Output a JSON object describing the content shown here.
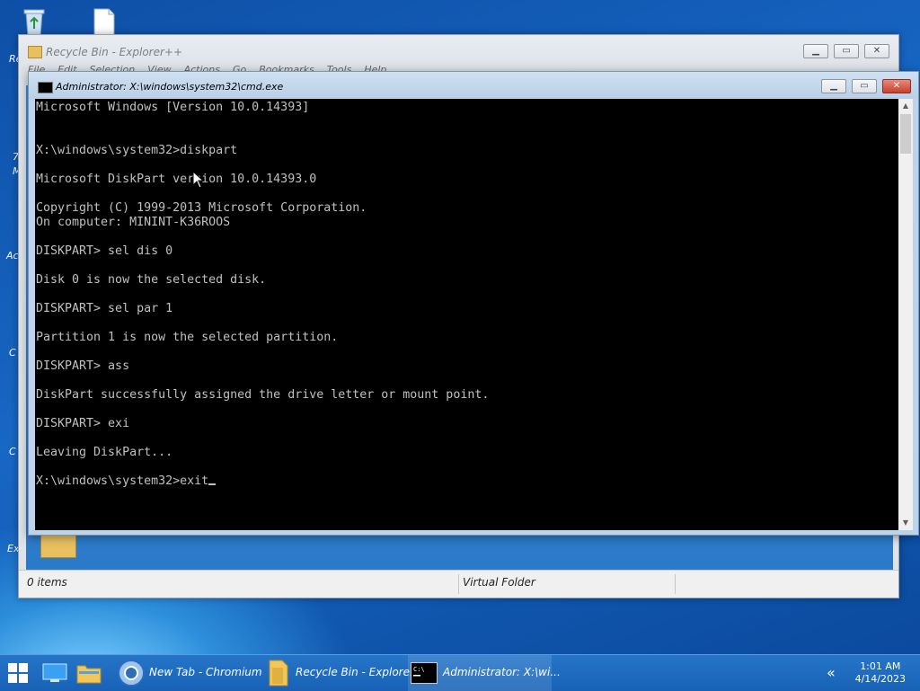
{
  "desktop": {
    "icons": [
      {
        "name": "recycle-bin",
        "label": "Re"
      },
      {
        "name": "file",
        "label": ""
      }
    ],
    "side_labels": [
      "7",
      "M",
      "Ac",
      "C",
      "C",
      "Ex"
    ]
  },
  "explorer": {
    "title": "Recycle Bin - Explorer++",
    "menu": [
      "File",
      "Edit",
      "Selection",
      "View",
      "Actions",
      "Go",
      "Bookmarks",
      "Tools",
      "Help"
    ],
    "status_left": "0 items",
    "status_right": "Virtual Folder"
  },
  "cmd": {
    "title": "Administrator: X:\\windows\\system32\\cmd.exe",
    "lines": [
      "Microsoft Windows [Version 10.0.14393]",
      "",
      "",
      "X:\\windows\\system32>diskpart",
      "",
      "Microsoft DiskPart version 10.0.14393.0",
      "",
      "Copyright (C) 1999-2013 Microsoft Corporation.",
      "On computer: MININT-K36ROOS",
      "",
      "DISKPART> sel dis 0",
      "",
      "Disk 0 is now the selected disk.",
      "",
      "DISKPART> sel par 1",
      "",
      "Partition 1 is now the selected partition.",
      "",
      "DISKPART> ass",
      "",
      "DiskPart successfully assigned the drive letter or mount point.",
      "",
      "DISKPART> exi",
      "",
      "Leaving DiskPart...",
      "",
      "X:\\windows\\system32>exit"
    ]
  },
  "taskbar": {
    "items": [
      {
        "label": "New Tab - Chromium",
        "icon": "chromium-icon"
      },
      {
        "label": "Recycle Bin - Explore...",
        "icon": "folder-icon"
      },
      {
        "label": "Administrator: X:\\wi...",
        "icon": "cmd-icon"
      }
    ],
    "clock_time": "1:01 AM",
    "clock_date": "4/14/2023",
    "tray_chevron": "«"
  }
}
